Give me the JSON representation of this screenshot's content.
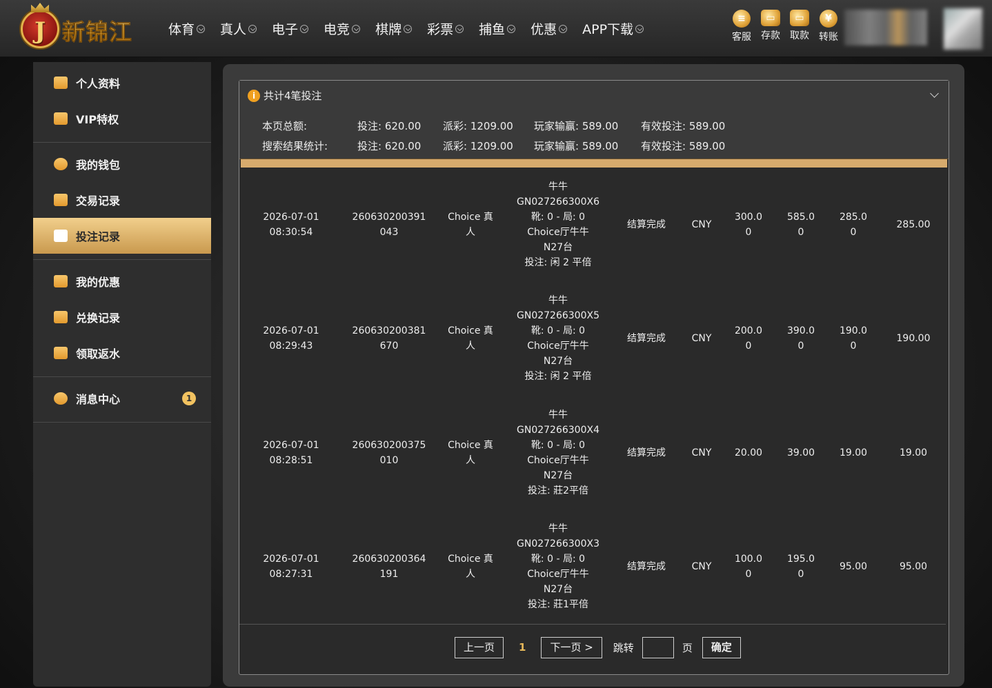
{
  "header": {
    "logo_letter": "J",
    "logo_text": "新锦江",
    "nav": [
      "体育",
      "真人",
      "电子",
      "电竞",
      "棋牌",
      "彩票",
      "捕鱼",
      "优惠",
      "APP下载"
    ],
    "quick": [
      {
        "label": "客服",
        "icon": "chat-icon",
        "glyph": "≡"
      },
      {
        "label": "存款",
        "icon": "wallet-icon",
        "glyph": "▭"
      },
      {
        "label": "取款",
        "icon": "card-icon",
        "glyph": "▭"
      },
      {
        "label": "转账",
        "icon": "coin-icon",
        "glyph": "¥"
      }
    ]
  },
  "sidebar": {
    "groups": [
      [
        {
          "label": "个人资料",
          "icon": "profile-card-icon"
        },
        {
          "label": "VIP特权",
          "icon": "vip-card-icon"
        }
      ],
      [
        {
          "label": "我的钱包",
          "icon": "piggy-bank-icon"
        },
        {
          "label": "交易记录",
          "icon": "document-icon"
        },
        {
          "label": "投注记录",
          "icon": "bet-record-icon",
          "active": true
        }
      ],
      [
        {
          "label": "我的优惠",
          "icon": "gift-icon"
        },
        {
          "label": "兑换记录",
          "icon": "money-bag-icon"
        },
        {
          "label": "领取返水",
          "icon": "rebate-icon"
        }
      ],
      [
        {
          "label": "消息中心",
          "icon": "bell-icon",
          "badge": "1"
        }
      ]
    ]
  },
  "summary": {
    "title": "共计4笔投注",
    "rows": [
      {
        "label": "本页总额:",
        "bet": "投注: 620.00",
        "payout": "派彩: 1209.00",
        "win": "玩家输赢: 589.00",
        "effective": "有效投注: 589.00"
      },
      {
        "label": "搜索结果统计:",
        "bet": "投注: 620.00",
        "payout": "派彩: 1209.00",
        "win": "玩家输赢: 589.00",
        "effective": "有效投注: 589.00"
      }
    ]
  },
  "records": [
    {
      "date": "2026-07-01",
      "time": "08:30:54",
      "no1": "260630200391",
      "no2": "043",
      "game": "Choice 真\n人",
      "detail": [
        "牛牛",
        "GN027266300X6",
        "靴: 0 - 局: 0",
        "Choice厅牛牛",
        "N27台",
        "投注: 闲 2 平倍"
      ],
      "status": "结算完成",
      "currency": "CNY",
      "bet": "300.0\n0",
      "payout": "585.0\n0",
      "win": "285.0\n0",
      "effective": "285.00"
    },
    {
      "date": "2026-07-01",
      "time": "08:29:43",
      "no1": "260630200381",
      "no2": "670",
      "game": "Choice 真\n人",
      "detail": [
        "牛牛",
        "GN027266300X5",
        "靴: 0 - 局: 0",
        "Choice厅牛牛",
        "N27台",
        "投注: 闲 2 平倍"
      ],
      "status": "结算完成",
      "currency": "CNY",
      "bet": "200.0\n0",
      "payout": "390.0\n0",
      "win": "190.0\n0",
      "effective": "190.00"
    },
    {
      "date": "2026-07-01",
      "time": "08:28:51",
      "no1": "260630200375",
      "no2": "010",
      "game": "Choice 真\n人",
      "detail": [
        "牛牛",
        "GN027266300X4",
        "靴: 0 - 局: 0",
        "Choice厅牛牛",
        "N27台",
        "投注: 莊2平倍"
      ],
      "status": "结算完成",
      "currency": "CNY",
      "bet": "20.00",
      "payout": "39.00",
      "win": "19.00",
      "effective": "19.00"
    },
    {
      "date": "2026-07-01",
      "time": "08:27:31",
      "no1": "260630200364",
      "no2": "191",
      "game": "Choice 真\n人",
      "detail": [
        "牛牛",
        "GN027266300X3",
        "靴: 0 - 局: 0",
        "Choice厅牛牛",
        "N27台",
        "投注: 莊1平倍"
      ],
      "status": "结算完成",
      "currency": "CNY",
      "bet": "100.0\n0",
      "payout": "195.0\n0",
      "win": "95.00",
      "effective": "95.00"
    }
  ],
  "pagination": {
    "prev": "上一页",
    "current": "1",
    "next": "下一页 >",
    "jump_label": "跳转",
    "page_suffix": "页",
    "confirm": "确定"
  }
}
